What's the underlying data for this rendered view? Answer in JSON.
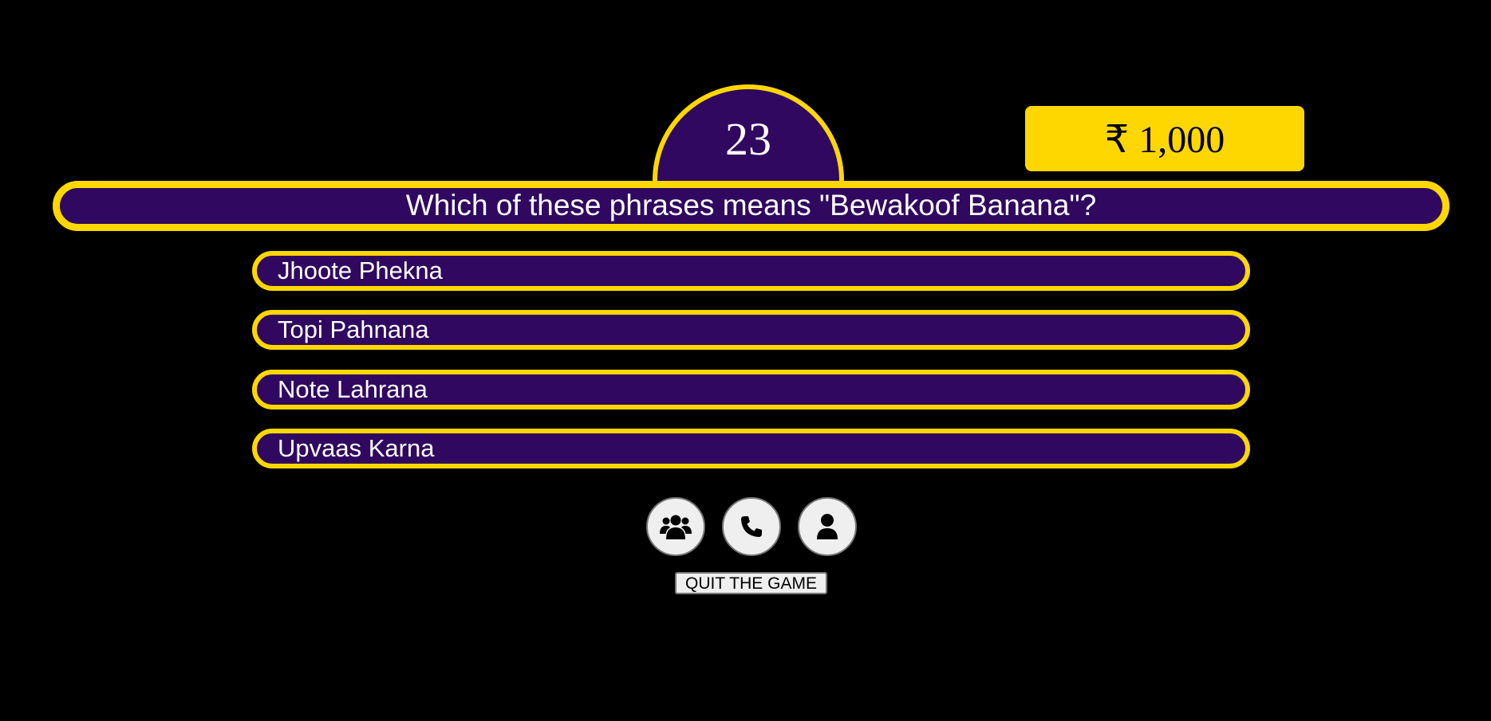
{
  "game": {
    "question_number": "23",
    "prize": "₹ 1,000",
    "question": "Which of these phrases means \"Bewakoof Banana\"?",
    "options": [
      {
        "label": "Jhoote Phekna"
      },
      {
        "label": "Topi Pahnana"
      },
      {
        "label": "Note Lahrana"
      },
      {
        "label": "Upvaas Karna"
      }
    ]
  },
  "lifelines": [
    {
      "icon": "users-icon"
    },
    {
      "icon": "phone-icon"
    },
    {
      "icon": "user-icon"
    }
  ],
  "quit_label": "QUIT THE GAME",
  "colors": {
    "background": "#000000",
    "panel": "#300860",
    "accent": "#ffd700",
    "text": "#ffffff"
  }
}
